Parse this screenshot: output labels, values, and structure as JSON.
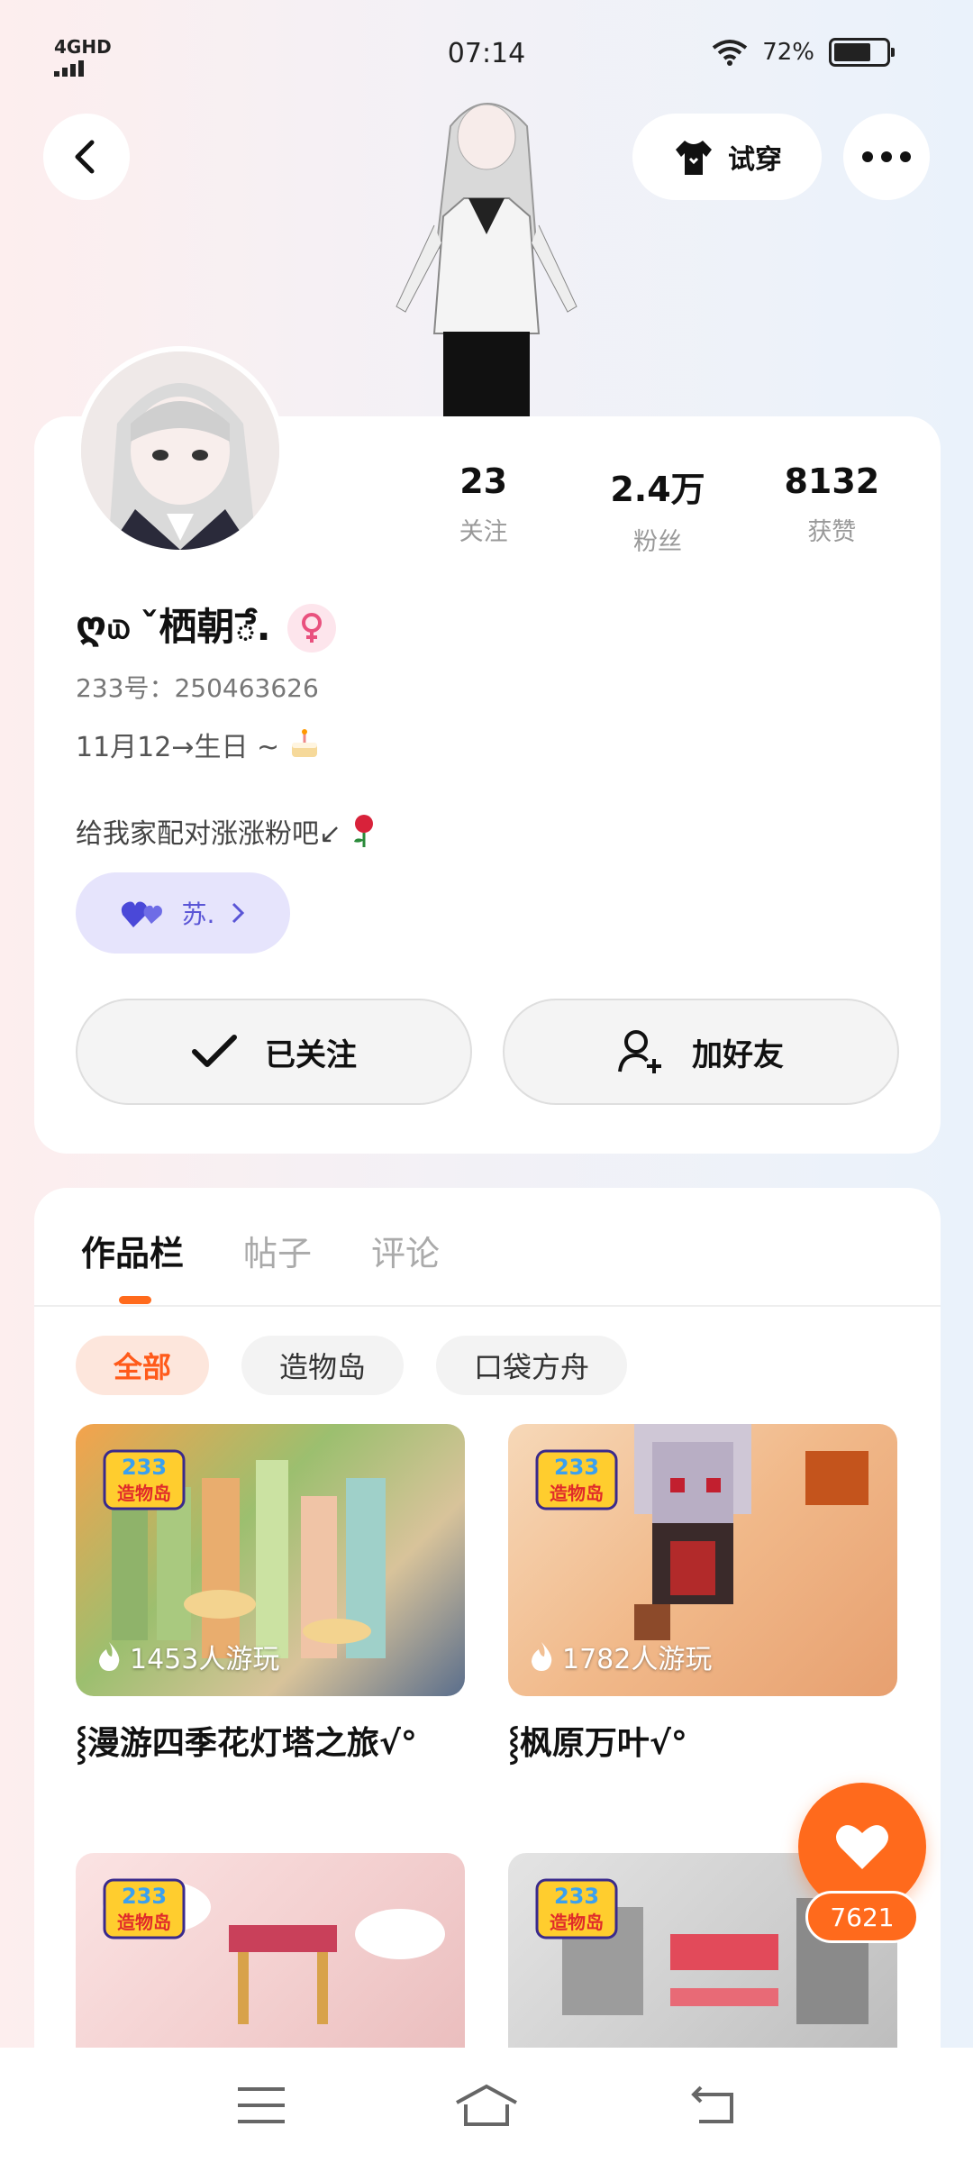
{
  "status": {
    "network": "4GHD",
    "time": "07:14",
    "battery": "72%",
    "battery_level": 0.72
  },
  "header": {
    "try_on_label": "试穿",
    "try_on_icon": "shirt-icon",
    "back_icon": "back-arrow-icon",
    "more_icon": "more-dots-icon"
  },
  "profile": {
    "stats": [
      {
        "value": "23",
        "label": "关注"
      },
      {
        "value": "2.4万",
        "label": "粉丝"
      },
      {
        "value": "8132",
        "label": "获赞"
      }
    ],
    "nickname_prefix": "ღ௰",
    "nickname": "ˇ栖朝ే.",
    "gender_icon": "female-icon",
    "gender_color": "#e9517e",
    "uid": "233号：250463626",
    "birthday": "11月12→生日 ~",
    "signature": "给我家配对涨涨粉吧↙",
    "cp_name": "苏.",
    "cp_icon": "couple-hearts-icon"
  },
  "actions": {
    "follow_label": "已关注",
    "add_friend_label": "加好友"
  },
  "works": {
    "tabs": [
      "作品栏",
      "帖子",
      "评论"
    ],
    "active_tab": 0,
    "filters": [
      "全部",
      "造物岛",
      "口袋方舟"
    ],
    "active_filter": 0,
    "badge_number": "233",
    "badge_text": "造物岛",
    "items": [
      {
        "players": "1453人游玩",
        "title": "⸾漫游四季花灯塔之旅√°"
      },
      {
        "players": "1782人游玩",
        "title": "⸾枫原万叶√°"
      },
      {
        "players": "",
        "title": ""
      },
      {
        "players": "",
        "title": ""
      }
    ]
  },
  "like": {
    "count": "7621",
    "icon": "heart-icon"
  },
  "accent_color": "#ff6a1c",
  "nav": {
    "menu_icon": "menu-icon",
    "home_icon": "home-icon",
    "back_icon": "return-icon"
  }
}
